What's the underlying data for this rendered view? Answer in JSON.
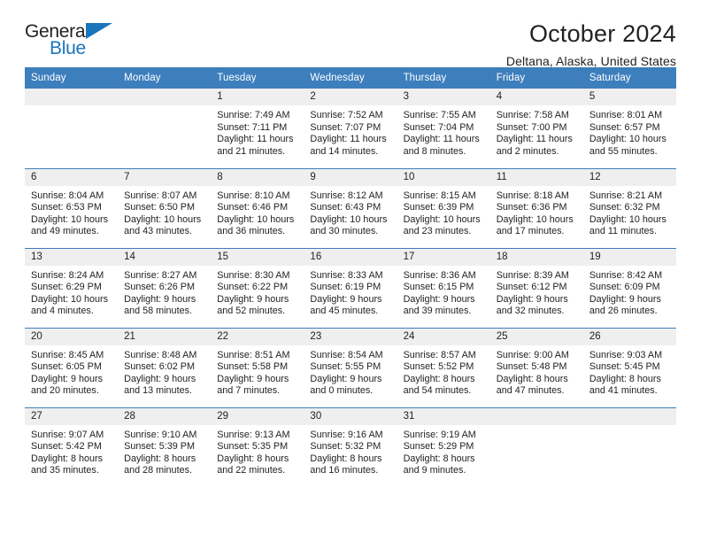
{
  "brand": {
    "name_top": "General",
    "name_bottom": "Blue",
    "color_blue": "#1b75bb",
    "color_dark": "#231f20"
  },
  "header": {
    "title": "October 2024",
    "subtitle": "Deltana, Alaska, United States"
  },
  "theme": {
    "header_blue": "#3d7ebc",
    "daynum_gray": "#efefef",
    "text": "#222222"
  },
  "weekday_headers": [
    "Sunday",
    "Monday",
    "Tuesday",
    "Wednesday",
    "Thursday",
    "Friday",
    "Saturday"
  ],
  "labels": {
    "sunrise_prefix": "Sunrise:",
    "sunset_prefix": "Sunset:",
    "daylight_prefix": "Daylight:"
  },
  "weeks": [
    [
      {
        "day": "",
        "empty": true
      },
      {
        "day": "",
        "empty": true
      },
      {
        "day": "1",
        "sunrise": "Sunrise: 7:49 AM",
        "sunset": "Sunset: 7:11 PM",
        "daylight_line1": "Daylight: 11 hours",
        "daylight_line2": "and 21 minutes."
      },
      {
        "day": "2",
        "sunrise": "Sunrise: 7:52 AM",
        "sunset": "Sunset: 7:07 PM",
        "daylight_line1": "Daylight: 11 hours",
        "daylight_line2": "and 14 minutes."
      },
      {
        "day": "3",
        "sunrise": "Sunrise: 7:55 AM",
        "sunset": "Sunset: 7:04 PM",
        "daylight_line1": "Daylight: 11 hours",
        "daylight_line2": "and 8 minutes."
      },
      {
        "day": "4",
        "sunrise": "Sunrise: 7:58 AM",
        "sunset": "Sunset: 7:00 PM",
        "daylight_line1": "Daylight: 11 hours",
        "daylight_line2": "and 2 minutes."
      },
      {
        "day": "5",
        "sunrise": "Sunrise: 8:01 AM",
        "sunset": "Sunset: 6:57 PM",
        "daylight_line1": "Daylight: 10 hours",
        "daylight_line2": "and 55 minutes."
      }
    ],
    [
      {
        "day": "6",
        "sunrise": "Sunrise: 8:04 AM",
        "sunset": "Sunset: 6:53 PM",
        "daylight_line1": "Daylight: 10 hours",
        "daylight_line2": "and 49 minutes."
      },
      {
        "day": "7",
        "sunrise": "Sunrise: 8:07 AM",
        "sunset": "Sunset: 6:50 PM",
        "daylight_line1": "Daylight: 10 hours",
        "daylight_line2": "and 43 minutes."
      },
      {
        "day": "8",
        "sunrise": "Sunrise: 8:10 AM",
        "sunset": "Sunset: 6:46 PM",
        "daylight_line1": "Daylight: 10 hours",
        "daylight_line2": "and 36 minutes."
      },
      {
        "day": "9",
        "sunrise": "Sunrise: 8:12 AM",
        "sunset": "Sunset: 6:43 PM",
        "daylight_line1": "Daylight: 10 hours",
        "daylight_line2": "and 30 minutes."
      },
      {
        "day": "10",
        "sunrise": "Sunrise: 8:15 AM",
        "sunset": "Sunset: 6:39 PM",
        "daylight_line1": "Daylight: 10 hours",
        "daylight_line2": "and 23 minutes."
      },
      {
        "day": "11",
        "sunrise": "Sunrise: 8:18 AM",
        "sunset": "Sunset: 6:36 PM",
        "daylight_line1": "Daylight: 10 hours",
        "daylight_line2": "and 17 minutes."
      },
      {
        "day": "12",
        "sunrise": "Sunrise: 8:21 AM",
        "sunset": "Sunset: 6:32 PM",
        "daylight_line1": "Daylight: 10 hours",
        "daylight_line2": "and 11 minutes."
      }
    ],
    [
      {
        "day": "13",
        "sunrise": "Sunrise: 8:24 AM",
        "sunset": "Sunset: 6:29 PM",
        "daylight_line1": "Daylight: 10 hours",
        "daylight_line2": "and 4 minutes."
      },
      {
        "day": "14",
        "sunrise": "Sunrise: 8:27 AM",
        "sunset": "Sunset: 6:26 PM",
        "daylight_line1": "Daylight: 9 hours",
        "daylight_line2": "and 58 minutes."
      },
      {
        "day": "15",
        "sunrise": "Sunrise: 8:30 AM",
        "sunset": "Sunset: 6:22 PM",
        "daylight_line1": "Daylight: 9 hours",
        "daylight_line2": "and 52 minutes."
      },
      {
        "day": "16",
        "sunrise": "Sunrise: 8:33 AM",
        "sunset": "Sunset: 6:19 PM",
        "daylight_line1": "Daylight: 9 hours",
        "daylight_line2": "and 45 minutes."
      },
      {
        "day": "17",
        "sunrise": "Sunrise: 8:36 AM",
        "sunset": "Sunset: 6:15 PM",
        "daylight_line1": "Daylight: 9 hours",
        "daylight_line2": "and 39 minutes."
      },
      {
        "day": "18",
        "sunrise": "Sunrise: 8:39 AM",
        "sunset": "Sunset: 6:12 PM",
        "daylight_line1": "Daylight: 9 hours",
        "daylight_line2": "and 32 minutes."
      },
      {
        "day": "19",
        "sunrise": "Sunrise: 8:42 AM",
        "sunset": "Sunset: 6:09 PM",
        "daylight_line1": "Daylight: 9 hours",
        "daylight_line2": "and 26 minutes."
      }
    ],
    [
      {
        "day": "20",
        "sunrise": "Sunrise: 8:45 AM",
        "sunset": "Sunset: 6:05 PM",
        "daylight_line1": "Daylight: 9 hours",
        "daylight_line2": "and 20 minutes."
      },
      {
        "day": "21",
        "sunrise": "Sunrise: 8:48 AM",
        "sunset": "Sunset: 6:02 PM",
        "daylight_line1": "Daylight: 9 hours",
        "daylight_line2": "and 13 minutes."
      },
      {
        "day": "22",
        "sunrise": "Sunrise: 8:51 AM",
        "sunset": "Sunset: 5:58 PM",
        "daylight_line1": "Daylight: 9 hours",
        "daylight_line2": "and 7 minutes."
      },
      {
        "day": "23",
        "sunrise": "Sunrise: 8:54 AM",
        "sunset": "Sunset: 5:55 PM",
        "daylight_line1": "Daylight: 9 hours",
        "daylight_line2": "and 0 minutes."
      },
      {
        "day": "24",
        "sunrise": "Sunrise: 8:57 AM",
        "sunset": "Sunset: 5:52 PM",
        "daylight_line1": "Daylight: 8 hours",
        "daylight_line2": "and 54 minutes."
      },
      {
        "day": "25",
        "sunrise": "Sunrise: 9:00 AM",
        "sunset": "Sunset: 5:48 PM",
        "daylight_line1": "Daylight: 8 hours",
        "daylight_line2": "and 47 minutes."
      },
      {
        "day": "26",
        "sunrise": "Sunrise: 9:03 AM",
        "sunset": "Sunset: 5:45 PM",
        "daylight_line1": "Daylight: 8 hours",
        "daylight_line2": "and 41 minutes."
      }
    ],
    [
      {
        "day": "27",
        "sunrise": "Sunrise: 9:07 AM",
        "sunset": "Sunset: 5:42 PM",
        "daylight_line1": "Daylight: 8 hours",
        "daylight_line2": "and 35 minutes."
      },
      {
        "day": "28",
        "sunrise": "Sunrise: 9:10 AM",
        "sunset": "Sunset: 5:39 PM",
        "daylight_line1": "Daylight: 8 hours",
        "daylight_line2": "and 28 minutes."
      },
      {
        "day": "29",
        "sunrise": "Sunrise: 9:13 AM",
        "sunset": "Sunset: 5:35 PM",
        "daylight_line1": "Daylight: 8 hours",
        "daylight_line2": "and 22 minutes."
      },
      {
        "day": "30",
        "sunrise": "Sunrise: 9:16 AM",
        "sunset": "Sunset: 5:32 PM",
        "daylight_line1": "Daylight: 8 hours",
        "daylight_line2": "and 16 minutes."
      },
      {
        "day": "31",
        "sunrise": "Sunrise: 9:19 AM",
        "sunset": "Sunset: 5:29 PM",
        "daylight_line1": "Daylight: 8 hours",
        "daylight_line2": "and 9 minutes."
      },
      {
        "day": "",
        "empty": true
      },
      {
        "day": "",
        "empty": true
      }
    ]
  ]
}
